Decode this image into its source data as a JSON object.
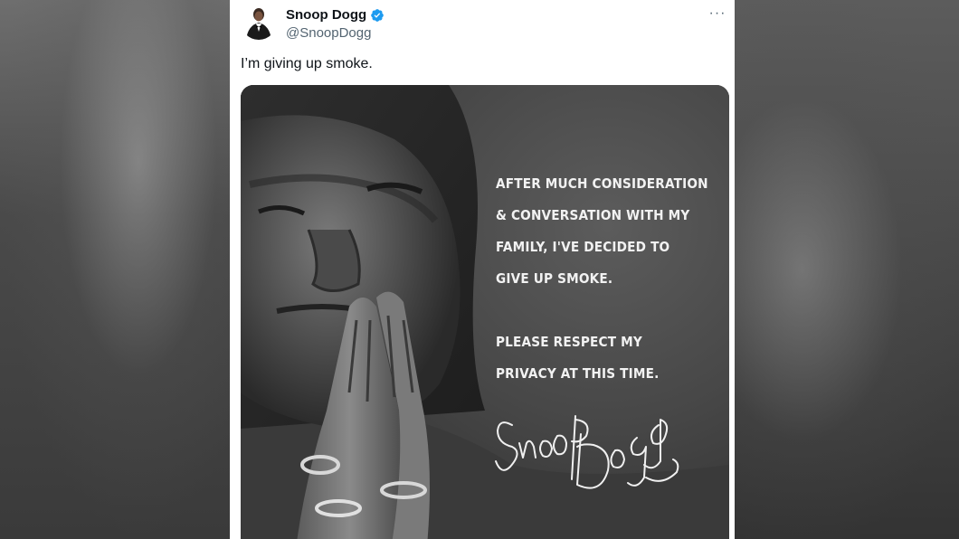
{
  "tweet": {
    "display_name": "Snoop Dogg",
    "handle": "@SnoopDogg",
    "more_label": "···",
    "text": "I’m giving up smoke.",
    "verified": true,
    "accent_color": "#1d9bf0"
  },
  "media": {
    "statement_lines": [
      "AFTER MUCH CONSIDERATION",
      "& CONVERSATION WITH MY",
      "FAMILY, I'VE DECIDED TO",
      "GIVE UP SMOKE."
    ],
    "statement_lines_2": [
      "PLEASE RESPECT MY",
      "PRIVACY AT THIS TIME."
    ],
    "signature_text": "Snoop Dogg"
  }
}
